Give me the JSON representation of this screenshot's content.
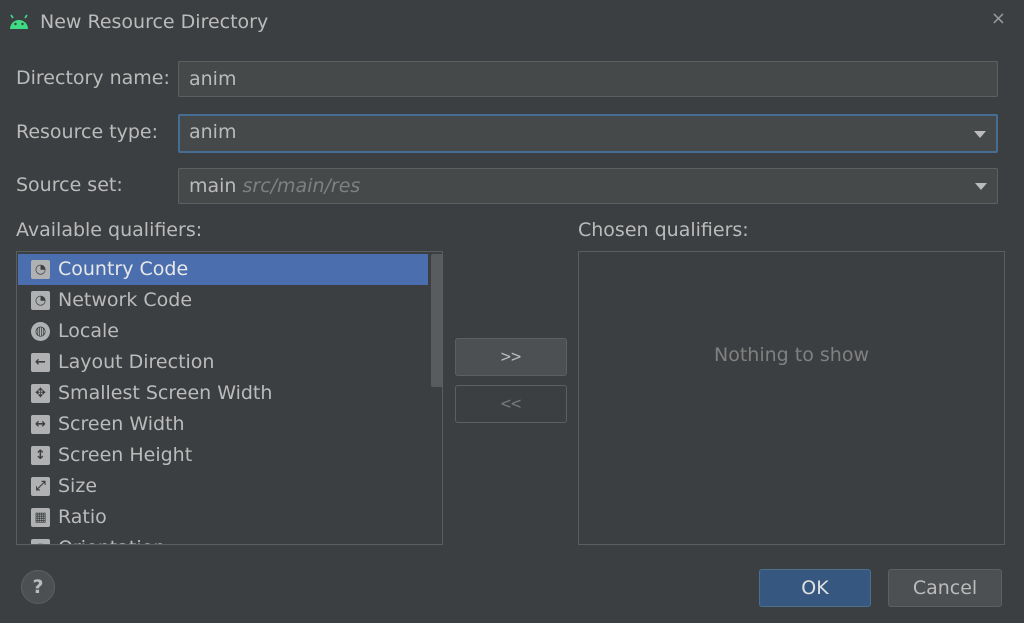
{
  "dialog": {
    "title": "New Resource Directory",
    "close_glyph": "×"
  },
  "form": {
    "directory_name_label": "Directory name:",
    "directory_name_value": "anim",
    "resource_type_label": "Resource type:",
    "resource_type_value": "anim",
    "source_set_label": "Source set:",
    "source_set_value": "main",
    "source_set_path": "src/main/res"
  },
  "qualifiers": {
    "available_label": "Available qualifiers:",
    "chosen_label": "Chosen qualifiers:",
    "empty_text": "Nothing to show",
    "items": [
      {
        "label": "Country Code",
        "icon": "country-code-icon",
        "glyph": "◔",
        "selected": true
      },
      {
        "label": "Network Code",
        "icon": "network-code-icon",
        "glyph": "◔",
        "selected": false
      },
      {
        "label": "Locale",
        "icon": "globe-icon",
        "glyph": "◍",
        "selected": false
      },
      {
        "label": "Layout Direction",
        "icon": "layout-direction-icon",
        "glyph": "←",
        "selected": false
      },
      {
        "label": "Smallest Screen Width",
        "icon": "smallest-screen-width-icon",
        "glyph": "✥",
        "selected": false
      },
      {
        "label": "Screen Width",
        "icon": "screen-width-icon",
        "glyph": "↔",
        "selected": false
      },
      {
        "label": "Screen Height",
        "icon": "screen-height-icon",
        "glyph": "↕",
        "selected": false
      },
      {
        "label": "Size",
        "icon": "size-icon",
        "glyph": "⤢",
        "selected": false
      },
      {
        "label": "Ratio",
        "icon": "ratio-icon",
        "glyph": "▦",
        "selected": false
      },
      {
        "label": "Orientation",
        "icon": "orientation-icon",
        "glyph": "▯",
        "selected": false
      }
    ],
    "add_button_label": ">>",
    "remove_button_label": "<<"
  },
  "buttons": {
    "help_label": "?",
    "ok_label": "OK",
    "cancel_label": "Cancel"
  },
  "colors": {
    "background": "#3c3f41",
    "selection": "#4b6eaf",
    "focus_border": "#466d94",
    "ok_button": "#365880",
    "android_green": "#3ddc84"
  }
}
